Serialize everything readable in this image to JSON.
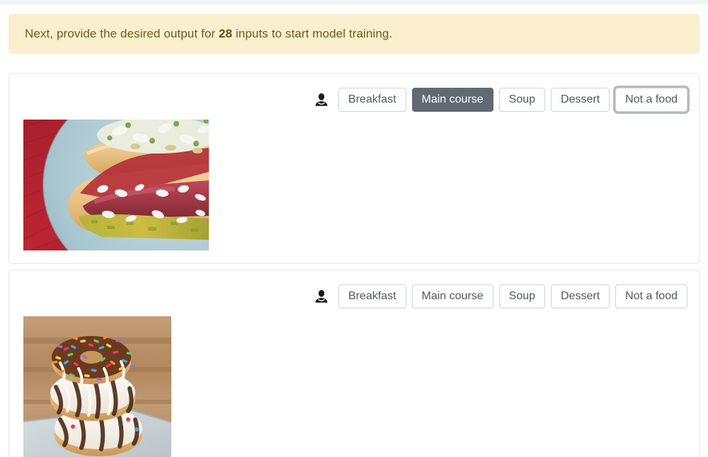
{
  "banner": {
    "prefix": "Next, provide the desired output for ",
    "count": "28",
    "suffix": " inputs to start model training.",
    "background_color": "#fcefcd",
    "text_color": "#6d5c21"
  },
  "labels": {
    "breakfast": "Breakfast",
    "main_course": "Main course",
    "soup": "Soup",
    "dessert": "Dessert",
    "not_a_food": "Not a food"
  },
  "colors": {
    "selected_background": "#616a72",
    "selected_text": "#ffffff",
    "button_border": "#ced4da",
    "button_text": "#51585e",
    "focus_ring": "#b4bac0",
    "card_border": "#e3e5e8",
    "top_strip": "#f1f4f7"
  },
  "cards": [
    {
      "annotator_icon": "person-icon",
      "image_alt": "hot dog with relish and chopped onions on a blue plate over a red background",
      "options": [
        {
          "label": "Breakfast",
          "selected": false,
          "focused": false
        },
        {
          "label": "Main course",
          "selected": true,
          "focused": false
        },
        {
          "label": "Soup",
          "selected": false,
          "focused": false
        },
        {
          "label": "Dessert",
          "selected": false,
          "focused": false
        },
        {
          "label": "Not a food",
          "selected": false,
          "focused": true
        }
      ]
    },
    {
      "annotator_icon": "person-icon",
      "image_alt": "stack of two donuts with rainbow sprinkles and chocolate and white drizzle on a wooden background",
      "options": [
        {
          "label": "Breakfast",
          "selected": false,
          "focused": false
        },
        {
          "label": "Main course",
          "selected": false,
          "focused": false
        },
        {
          "label": "Soup",
          "selected": false,
          "focused": false
        },
        {
          "label": "Dessert",
          "selected": false,
          "focused": false
        },
        {
          "label": "Not a food",
          "selected": false,
          "focused": false
        }
      ]
    }
  ]
}
